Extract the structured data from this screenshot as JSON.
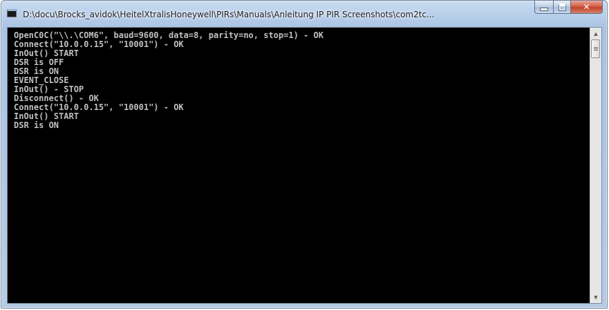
{
  "window": {
    "title": "D:\\docu\\Brocks_avidok\\HeitelXtralisHoneywell\\PIRs\\Manuals\\Anleitung IP PIR Screenshots\\com2tc...",
    "controls": {
      "minimize_icon": "minimize-icon",
      "maximize_icon": "maximize-icon",
      "close_icon": "close-icon",
      "close_glyph": "✕"
    }
  },
  "console": {
    "lines": [
      "OpenC0C(\"\\\\.\\COM6\", baud=9600, data=8, parity=no, stop=1) - OK",
      "Connect(\"10.0.0.15\", \"10001\") - OK",
      "InOut() START",
      "DSR is OFF",
      "DSR is ON",
      "EVENT_CLOSE",
      "InOut() - STOP",
      "Disconnect() - OK",
      "Connect(\"10.0.0.15\", \"10001\") - OK",
      "InOut() START",
      "DSR is ON"
    ],
    "background": "#000000",
    "text_color": "#c0c0c0"
  },
  "scrollbar": {
    "up_icon": "scroll-up-arrow-icon",
    "down_icon": "scroll-down-arrow-icon",
    "up_glyph": "▲",
    "down_glyph": "▼"
  }
}
